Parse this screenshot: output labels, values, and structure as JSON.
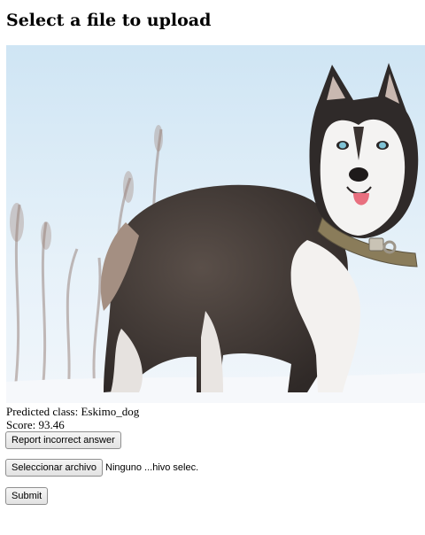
{
  "page": {
    "title": "Select a file to upload"
  },
  "image": {
    "subject": "siberian husky in snow"
  },
  "prediction": {
    "class_label": "Predicted class:",
    "class_value": "Eskimo_dog",
    "score_label": "Score:",
    "score_value": "93.46"
  },
  "actions": {
    "report_label": "Report incorrect answer",
    "choose_file_label": "Seleccionar archivo",
    "file_status": "Ninguno ...hivo selec.",
    "submit_label": "Submit"
  },
  "colors": {
    "snow": "#f4f7fb",
    "sky": "#dfeef8",
    "dog_dark": "#3b3431",
    "dog_white": "#f3f1ef",
    "collar": "#8a7c5a",
    "eye": "#7fc3d6"
  }
}
